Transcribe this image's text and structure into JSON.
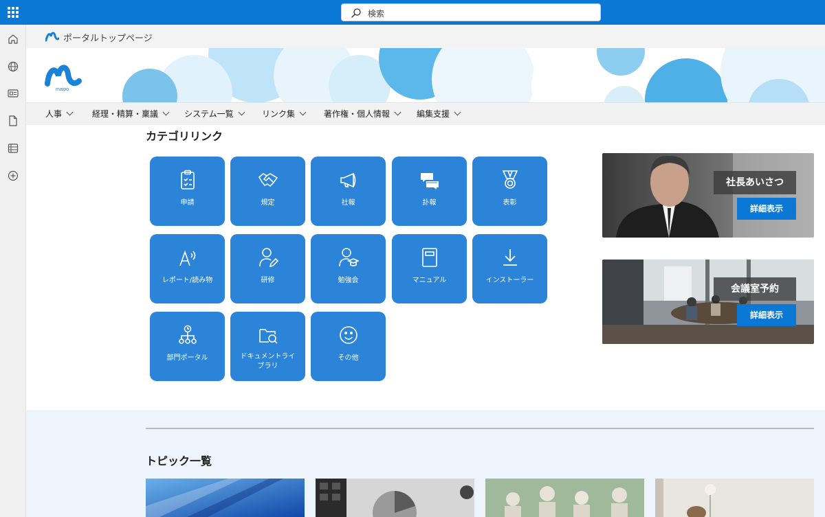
{
  "search": {
    "placeholder": "検索"
  },
  "site": {
    "name": "ポータルトップページ",
    "logo_text": "maipo"
  },
  "nav": [
    {
      "label": "人事"
    },
    {
      "label": "経理・精算・稟議"
    },
    {
      "label": "システム一覧"
    },
    {
      "label": "リンク集"
    },
    {
      "label": "著作権・個人情報"
    },
    {
      "label": "編集支援"
    }
  ],
  "category": {
    "title": "カテゴリリンク",
    "tiles": [
      {
        "label": "申請",
        "icon": "clipboard-icon"
      },
      {
        "label": "規定",
        "icon": "handshake-icon"
      },
      {
        "label": "社報",
        "icon": "megaphone-icon"
      },
      {
        "label": "訃報",
        "icon": "chat-icon"
      },
      {
        "label": "表彰",
        "icon": "medal-icon"
      },
      {
        "label": "レポート/読み物",
        "icon": "read-aloud-icon"
      },
      {
        "label": "研修",
        "icon": "person-edit-icon"
      },
      {
        "label": "勉強会",
        "icon": "person-graduation-icon"
      },
      {
        "label": "マニュアル",
        "icon": "book-icon"
      },
      {
        "label": "インストーラー",
        "icon": "download-icon"
      },
      {
        "label": "部門ポータル",
        "icon": "org-chart-icon"
      },
      {
        "label": "ドキュメントライ\nブラリ",
        "line1": "ドキュメントライ",
        "line2": "ブラリ",
        "icon": "folder-search-icon"
      },
      {
        "label": "その他",
        "icon": "smiley-icon"
      }
    ]
  },
  "promos": [
    {
      "title": "社長あいさつ",
      "button": "詳細表示"
    },
    {
      "title": "会議室予約",
      "button": "詳細表示"
    }
  ],
  "topics": {
    "title": "トピック一覧"
  },
  "colors": {
    "brand": "#0a78d4",
    "tile": "#2b84d8",
    "lower_bg": "#eef4fb"
  }
}
